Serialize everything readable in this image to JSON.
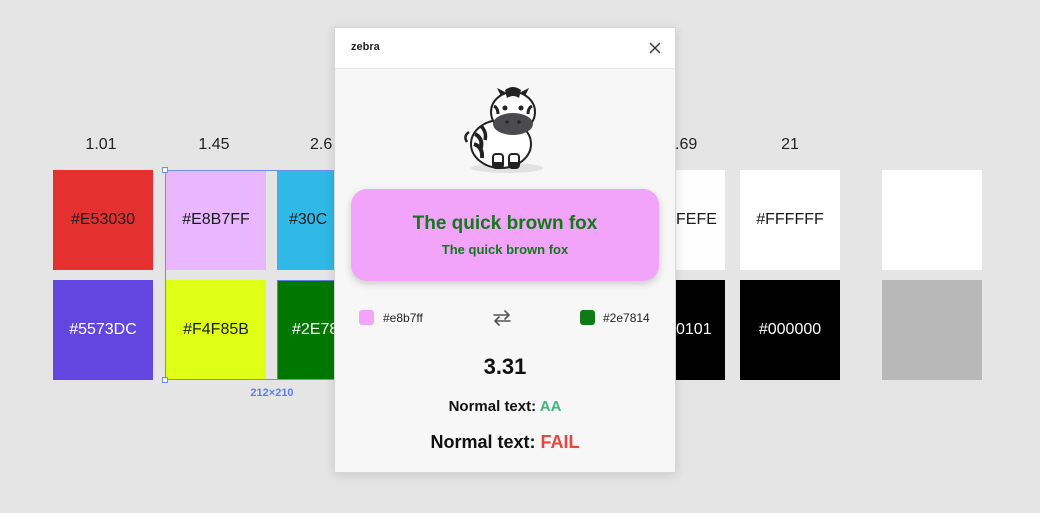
{
  "ratios": [
    "1.01",
    "1.45",
    "2.6",
    ".69",
    "21"
  ],
  "swatches_top": [
    {
      "label": "#E53030",
      "bg": "#E53030",
      "fg": "#1a1a1a"
    },
    {
      "label": "#E8B7FF",
      "bg": "#E8B7FF",
      "fg": "#1a1a1a"
    },
    {
      "label": "#30C",
      "bg": "#30B8E6",
      "fg": "#1a1a1a"
    },
    {
      "label": "FEFE",
      "bg": "#FEFEFE",
      "fg": "#1a1a1a"
    },
    {
      "label": "#FFFFFF",
      "bg": "#FFFFFF",
      "fg": "#1a1a1a"
    },
    {
      "label": "",
      "bg": "#FFFFFF",
      "fg": "#1a1a1a"
    }
  ],
  "swatches_bottom": [
    {
      "label": "#5573DC",
      "bg": "#6246E0",
      "fg": "#ffffff"
    },
    {
      "label": "#F4F85B",
      "bg": "#E0FF16",
      "fg": "#1a1a1a"
    },
    {
      "label": "#2E78",
      "bg": "#007800",
      "fg": "#ffffff"
    },
    {
      "label": "0101",
      "bg": "#000000",
      "fg": "#ffffff"
    },
    {
      "label": "#000000",
      "bg": "#000000",
      "fg": "#ffffff"
    },
    {
      "label": "",
      "bg": "#B8B8B8",
      "fg": "#1a1a1a"
    }
  ],
  "selection": {
    "dimensions": "212×210"
  },
  "plugin": {
    "title": "zebra",
    "preview": {
      "big_text": "The quick brown fox",
      "small_text": "The quick brown fox",
      "background": "#F1A4FA",
      "foreground": "#0F7A16"
    },
    "color1": {
      "hex": "#e8b7ff",
      "swatch": "#F1A4FA"
    },
    "color2": {
      "hex": "#2e7814",
      "swatch": "#0F7A16"
    },
    "contrast_ratio": "3.31",
    "results": [
      {
        "label": "Normal text: ",
        "status": "AA",
        "status_color": "#3DBA7A"
      },
      {
        "label": "Normal text: ",
        "status": "FAIL",
        "status_color": "#E8453C"
      }
    ]
  }
}
